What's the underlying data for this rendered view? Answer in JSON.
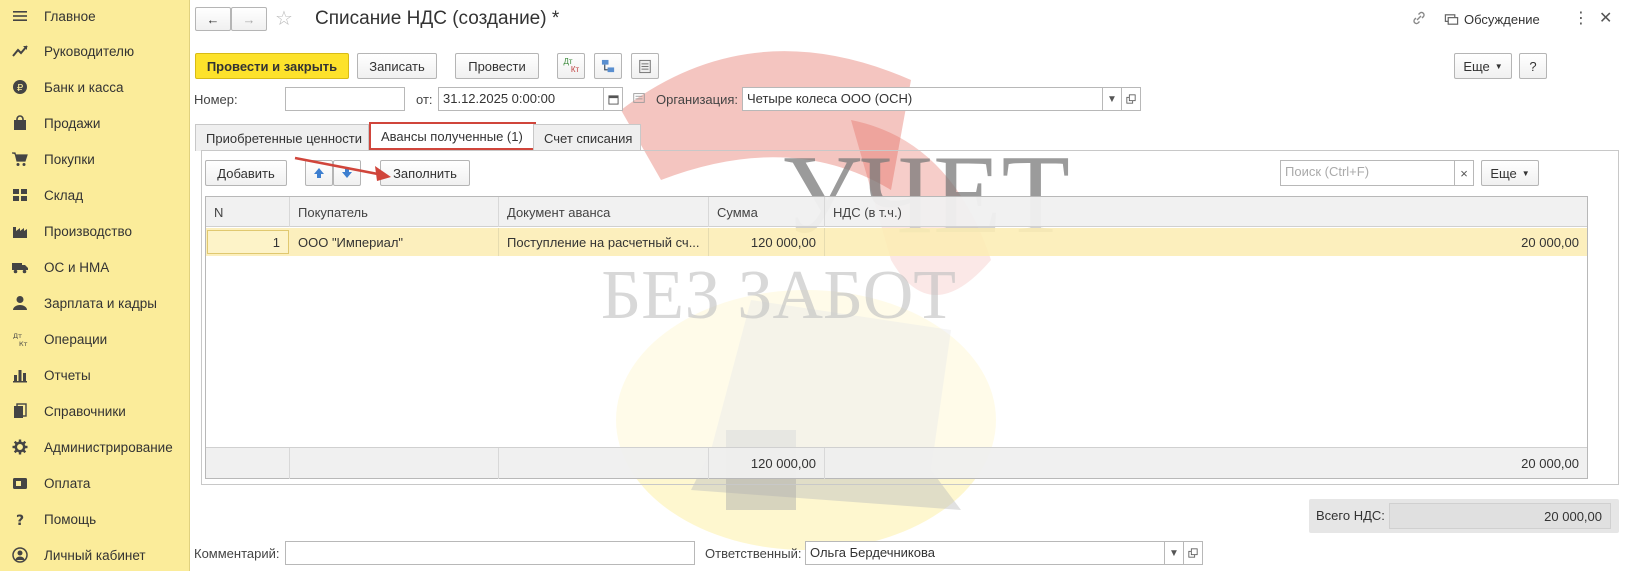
{
  "sidebar": {
    "items": [
      {
        "label": "Главное",
        "icon": "menu-icon"
      },
      {
        "label": "Руководителю",
        "icon": "trend-up-icon"
      },
      {
        "label": "Банк и касса",
        "icon": "ruble-coin-icon"
      },
      {
        "label": "Продажи",
        "icon": "shopping-bag-icon"
      },
      {
        "label": "Покупки",
        "icon": "cart-icon"
      },
      {
        "label": "Склад",
        "icon": "warehouse-grid-icon"
      },
      {
        "label": "Производство",
        "icon": "factory-icon"
      },
      {
        "label": "ОС и НМА",
        "icon": "truck-icon"
      },
      {
        "label": "Зарплата и кадры",
        "icon": "person-icon"
      },
      {
        "label": "Операции",
        "icon": "dt-kt-icon"
      },
      {
        "label": "Отчеты",
        "icon": "bar-chart-icon"
      },
      {
        "label": "Справочники",
        "icon": "books-icon"
      },
      {
        "label": "Администрирование",
        "icon": "gear-icon"
      },
      {
        "label": "Оплата",
        "icon": "wallet-icon"
      },
      {
        "label": "Помощь",
        "icon": "question-icon"
      },
      {
        "label": "Личный кабинет",
        "icon": "user-circle-icon"
      }
    ]
  },
  "header": {
    "title": "Списание НДС (создание) *",
    "discussion": "Обсуждение"
  },
  "toolbar": {
    "post_close": "Провести и закрыть",
    "save": "Записать",
    "post": "Провести",
    "dtkt_top": "Дт",
    "dtkt_bottom": "Кт",
    "more": "Еще",
    "help": "?"
  },
  "form": {
    "number_label": "Номер:",
    "number_value": "",
    "from_label": "от:",
    "date_value": "31.12.2025  0:00:00",
    "org_label": "Организация:",
    "org_value": "Четыре колеса ООО (ОСН)",
    "comment_label": "Комментарий:",
    "comment_value": "",
    "responsible_label": "Ответственный:",
    "responsible_value": "Ольга Бердечникова"
  },
  "tabs": [
    {
      "label": "Приобретенные ценности"
    },
    {
      "label": "Авансы полученные (1)"
    },
    {
      "label": "Счет списания"
    }
  ],
  "table_toolbar": {
    "add": "Добавить",
    "fill": "Заполнить",
    "search_placeholder": "Поиск (Ctrl+F)",
    "clear": "×",
    "more": "Еще"
  },
  "table": {
    "columns": [
      "N",
      "Покупатель",
      "Документ аванса",
      "Сумма",
      "НДС (в т.ч.)"
    ],
    "rows": [
      {
        "n": "1",
        "buyer": "ООО \"Империал\"",
        "doc": "Поступление на расчетный сч...",
        "sum": "120 000,00",
        "vat": "20 000,00"
      }
    ],
    "footer": {
      "sum": "120 000,00",
      "vat": "20 000,00"
    }
  },
  "totals": {
    "label": "Всего НДС:",
    "value": "20 000,00"
  },
  "watermark": {
    "line1": "УЧЕТ",
    "line2": "БЕЗ ЗАБОТ"
  },
  "colors": {
    "sidebar_bg": "#fbec9a",
    "primary_button": "#fde22b",
    "highlight_row": "#fbecb2",
    "annotation_red": "#d0453b"
  }
}
